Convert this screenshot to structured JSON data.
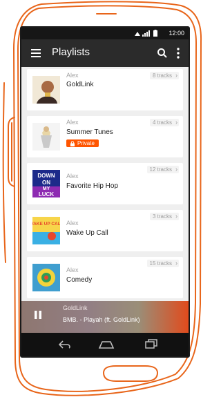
{
  "status_bar": {
    "time": "12:00"
  },
  "app_bar": {
    "title": "Playlists"
  },
  "playlists": [
    {
      "owner": "Alex",
      "title": "GoldLink",
      "tracks": "8 tracks",
      "private": null
    },
    {
      "owner": "Alex",
      "title": "Summer Tunes",
      "tracks": "4 tracks",
      "private": "Private"
    },
    {
      "owner": "Alex",
      "title": "Favorite Hip Hop",
      "tracks": "12 tracks",
      "private": null,
      "art_text": "DOWN ON MY LUCK"
    },
    {
      "owner": "Alex",
      "title": "Wake Up Call",
      "tracks": "3 tracks",
      "private": null,
      "art_text": "WAKE UP CALL"
    },
    {
      "owner": "Alex",
      "title": "Comedy",
      "tracks": "15 tracks",
      "private": null
    }
  ],
  "player": {
    "artist": "GoldLink",
    "track": "BMB. - Playah (ft. GoldLink)"
  },
  "colors": {
    "accent": "#ff5500",
    "outline": "#e8651a",
    "appbar": "#2b2b2b"
  },
  "icons": [
    "menu-icon",
    "search-icon",
    "more-icon",
    "lock-icon",
    "chevron-right-icon",
    "pause-icon",
    "back-icon",
    "home-icon",
    "recents-icon",
    "wifi-icon",
    "signal-icon",
    "battery-icon"
  ]
}
